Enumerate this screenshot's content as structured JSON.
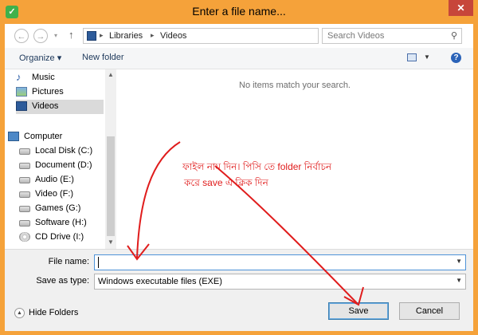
{
  "window": {
    "title": "Enter a file name...",
    "close_glyph": "✕"
  },
  "address_bar": {
    "back_glyph": "←",
    "forward_glyph": "→",
    "up_glyph": "↑",
    "crumbs": [
      "Libraries",
      "Videos"
    ],
    "search_placeholder": "Search Videos"
  },
  "toolbar": {
    "organize_label": "Organize ▾",
    "new_folder_label": "New folder",
    "help_glyph": "?"
  },
  "nav": {
    "libraries": [
      {
        "label": "Music",
        "icon": "music-icon"
      },
      {
        "label": "Pictures",
        "icon": "pictures-icon"
      },
      {
        "label": "Videos",
        "icon": "videos-icon",
        "selected": true
      }
    ],
    "computer_label": "Computer",
    "drives": [
      {
        "label": "Local Disk (C:)",
        "icon": "drive-icon"
      },
      {
        "label": "Document (D:)",
        "icon": "drive-icon"
      },
      {
        "label": "Audio (E:)",
        "icon": "drive-icon"
      },
      {
        "label": "Video (F:)",
        "icon": "drive-icon"
      },
      {
        "label": "Games (G:)",
        "icon": "drive-icon"
      },
      {
        "label": "Software (H:)",
        "icon": "drive-icon"
      },
      {
        "label": "CD Drive (I:)",
        "icon": "cd-drive-icon"
      }
    ]
  },
  "content": {
    "empty_message": "No items match your search.",
    "annotation_line1": "ফাইল নাম দিন। পিসি তে folder নির্বাচন",
    "annotation_line2": "করে save এ ক্লিক দিন"
  },
  "form": {
    "file_name_label": "File name:",
    "file_name_value": "",
    "save_type_label": "Save as type:",
    "save_type_value": "Windows executable files (EXE)"
  },
  "footer": {
    "hide_folders_label": "Hide Folders",
    "save_label": "Save",
    "cancel_label": "Cancel"
  },
  "colors": {
    "title_bar": "#f5a23a",
    "annotation_red": "#e01c1c",
    "accent": "#4f93d8"
  }
}
